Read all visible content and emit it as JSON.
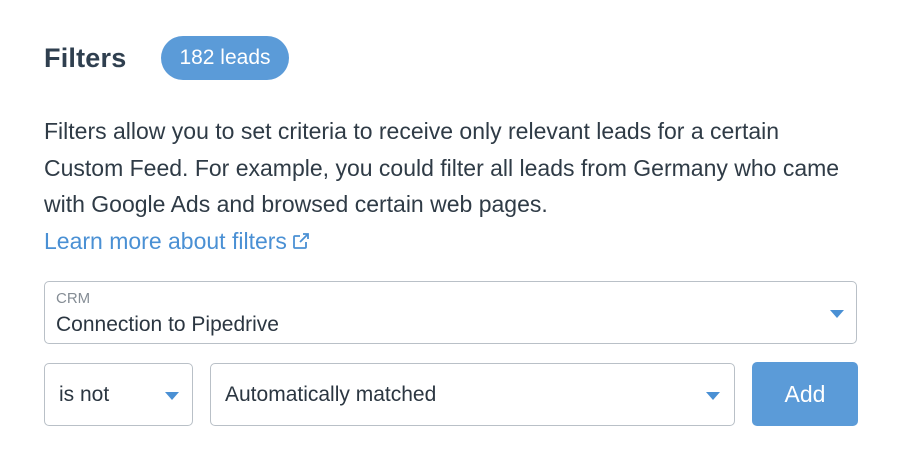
{
  "header": {
    "title": "Filters",
    "badge": "182 leads"
  },
  "description": {
    "text": "Filters allow you to set criteria to receive only relevant leads for a certain Custom Feed. For example, you could filter all leads from Germany who came with Google Ads and browsed certain web pages.",
    "link_label": "Learn more about filters",
    "link_icon": "external-link-icon"
  },
  "crm_select": {
    "label": "CRM",
    "value": "Connection to Pipedrive"
  },
  "operator_select": {
    "value": "is not"
  },
  "value_select": {
    "value": "Automatically matched"
  },
  "add_button": {
    "label": "Add"
  },
  "colors": {
    "accent": "#5b9bd8",
    "link": "#4a90d4",
    "text": "#2f3b46",
    "border": "#b9c0c7"
  }
}
